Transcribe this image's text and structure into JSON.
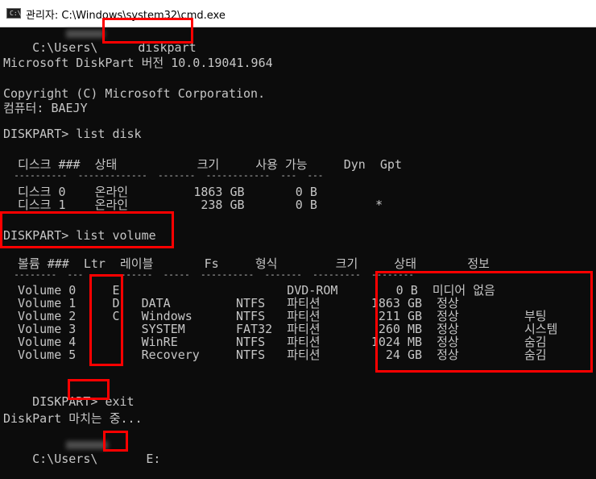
{
  "window": {
    "title": "관리자: C:\\Windows\\system32\\cmd.exe",
    "icon": "cmd-icon"
  },
  "console": {
    "prompt1": "C:\\Users\\",
    "cmd_diskpart": "diskpart",
    "version": "Microsoft DiskPart 버전 10.0.19041.964",
    "copyright": "Copyright (C) Microsoft Corporation.",
    "computer": "컴퓨터: BAEJY",
    "cmd_list_disk": "DISKPART> list disk",
    "disk_header": "  디스크 ###  상태           크기     사용 가능     Dyn  Gpt",
    "disk_sep": "  ----------  -------------  -------  ------------  ---  ---",
    "disk_rows": [
      "  디스크 0    온라인         1863 GB       0 B",
      "  디스크 1    온라인          238 GB       0 B        *"
    ],
    "cmd_list_volume": "DISKPART> list volume",
    "vol_header": "  볼륨 ###  Ltr  레이블       Fs     형식        크기     상태       정보",
    "vol_sep": "  --------  ---  -----------  -----  ----------  -------  ---------  --------",
    "vol_rows": [
      "  Volume 0     E                       DVD-ROM        0 B  미디어 없음",
      "  Volume 1     D   DATA         NTFS   파티션       1863 GB  정상",
      "  Volume 2     C   Windows      NTFS   파티션        211 GB  정상         부팅",
      "  Volume 3         SYSTEM       FAT32  파티션        260 MB  정상         시스템",
      "  Volume 4         WinRE        NTFS   파티션       1024 MB  정상         숨김",
      "  Volume 5         Recovery     NTFS   파티션         24 GB  정상         숨김"
    ],
    "cmd_exit_prompt": "DISKPART> ",
    "cmd_exit": "exit",
    "exiting": "DiskPart 마치는 중...",
    "prompt_final": "C:\\Users\\",
    "final_drive": "E:"
  },
  "annotation_color": "#ff0000"
}
